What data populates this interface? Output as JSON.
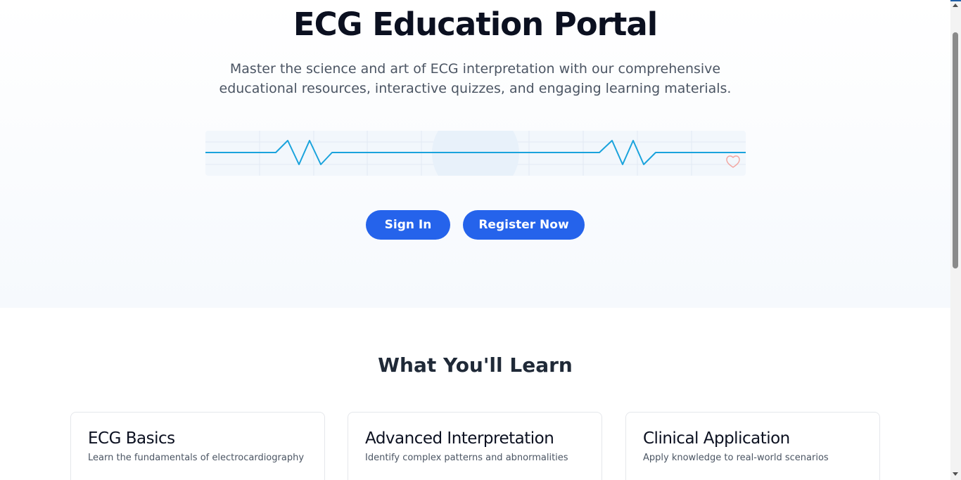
{
  "hero": {
    "title": "ECG Education Portal",
    "subtitle": "Master the science and art of ECG interpretation with our comprehensive educational resources, interactive quizzes, and engaging learning materials.",
    "signin_label": "Sign In",
    "register_label": "Register Now"
  },
  "ecg_strip": {
    "line_color": "#1aa3dc",
    "heart_icon": "heart-icon",
    "heart_color": "#f3a5a0"
  },
  "learn": {
    "title": "What You'll Learn",
    "cards": [
      {
        "title": "ECG Basics",
        "description": "Learn the fundamentals of electrocardiography"
      },
      {
        "title": "Advanced Interpretation",
        "description": "Identify complex patterns and abnormalities"
      },
      {
        "title": "Clinical Application",
        "description": "Apply knowledge to real-world scenarios"
      }
    ]
  },
  "colors": {
    "primary_button": "#2563eb",
    "top_accent": "#1f5fa8"
  }
}
